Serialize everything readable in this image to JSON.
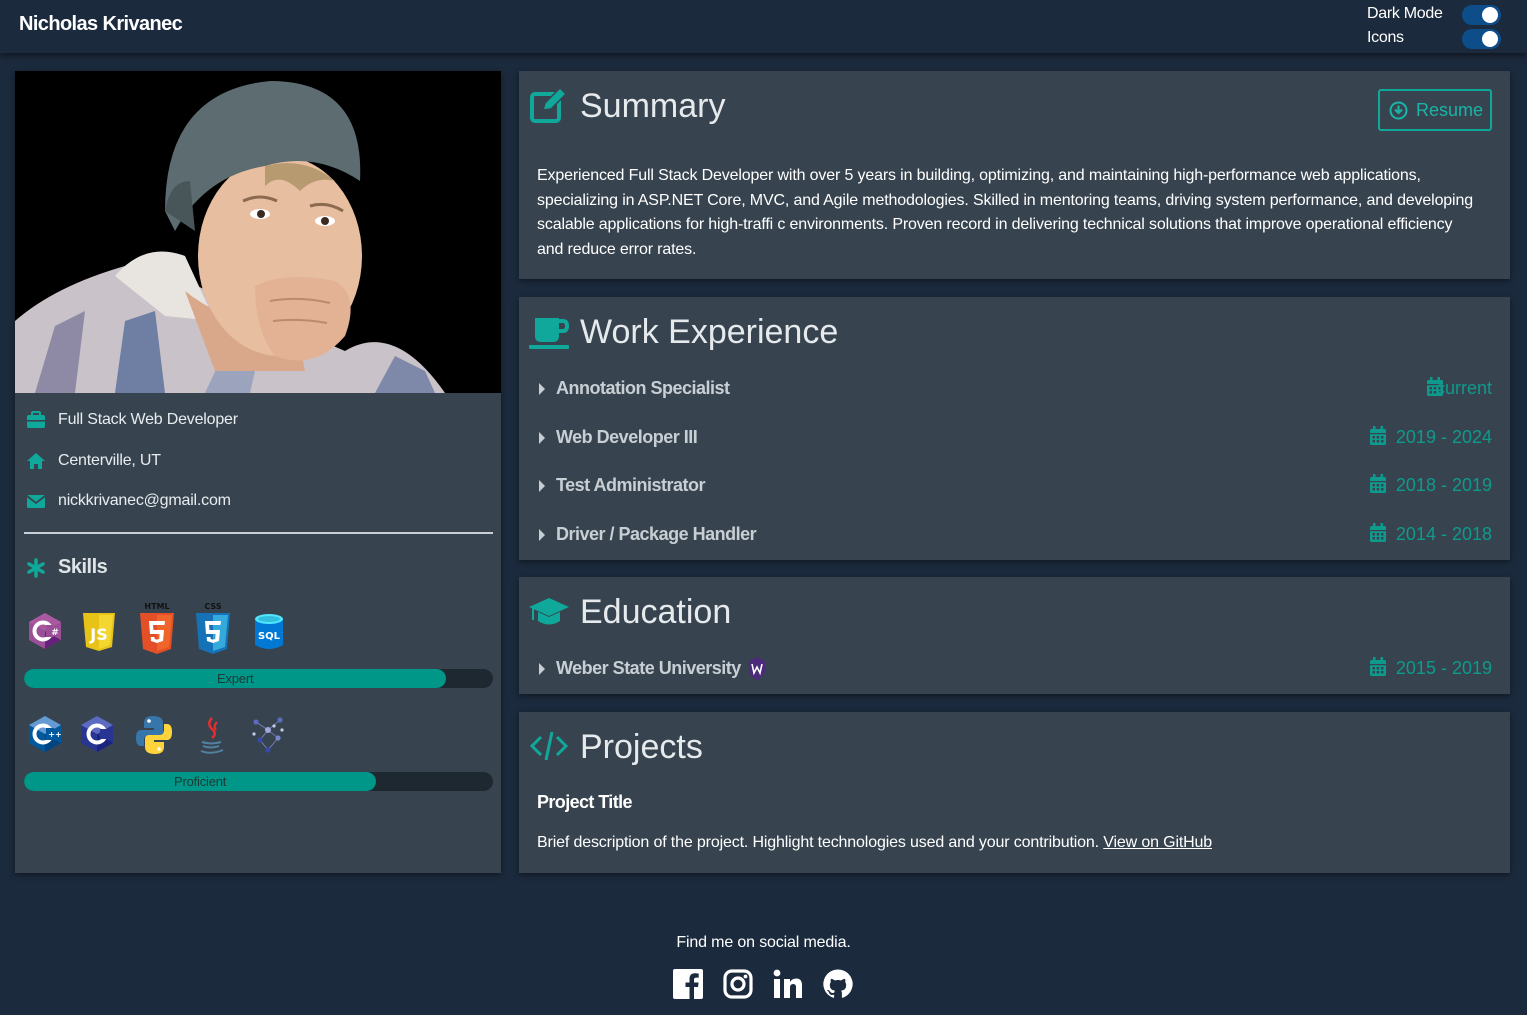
{
  "header": {
    "brand": "Nicholas Krivanec",
    "toggles": [
      {
        "label": "Dark Mode",
        "on": true
      },
      {
        "label": "Icons",
        "on": true
      }
    ]
  },
  "profile": {
    "title": "Full Stack Web Developer",
    "location": "Centerville, UT",
    "email": "nickkrivanec@gmail.com",
    "skills_heading": "Skills",
    "expert_label": "Expert",
    "expert_level": 0.9,
    "expert_icons": [
      "csharp-icon",
      "javascript-icon",
      "html5-icon",
      "css3-icon",
      "sql-icon"
    ],
    "expert_icon_captions": {
      "html": "HTML",
      "css": "CSS",
      "sql": "SQL"
    },
    "proficient_label": "Proficient",
    "proficient_level": 0.75,
    "proficient_icons": [
      "cplusplus-icon",
      "c-icon",
      "python-icon",
      "java-icon",
      "machine-learning-icon"
    ]
  },
  "summary": {
    "heading": "Summary",
    "resume_label": "Resume",
    "text": "Experienced Full Stack Developer with over 5 years in building, optimizing, and maintaining high-performance web applications, specializing in ASP.NET Core, MVC, and Agile methodologies. Skilled in mentoring teams, driving system performance, and developing scalable applications for high-traffi c environments. Proven record in delivering technical solutions that improve operational efficiency and reduce error rates."
  },
  "work": {
    "heading": "Work Experience",
    "jobs": [
      {
        "title": "Annotation Specialist",
        "dates": "current"
      },
      {
        "title": "Web Developer III",
        "dates": "2019 - 2024"
      },
      {
        "title": "Test Administrator",
        "dates": "2018 - 2019"
      },
      {
        "title": "Driver / Package Handler",
        "dates": "2014 - 2018"
      }
    ]
  },
  "education": {
    "heading": "Education",
    "schools": [
      {
        "name": "Weber State University",
        "dates": "2015 - 2019"
      }
    ]
  },
  "projects": {
    "heading": "Projects",
    "items": [
      {
        "title": "Project Title",
        "description": "Brief description of the project. Highlight technologies used and your contribution. ",
        "link_label": "View on GitHub"
      }
    ]
  },
  "footer": {
    "text": "Find me on social media.",
    "social": [
      "facebook-icon",
      "instagram-icon",
      "linkedin-icon",
      "github-icon"
    ]
  },
  "colors": {
    "accent": "#009688",
    "background": "#1b2a3d",
    "card": "#37444f",
    "toggle": "#0d4d8a"
  }
}
